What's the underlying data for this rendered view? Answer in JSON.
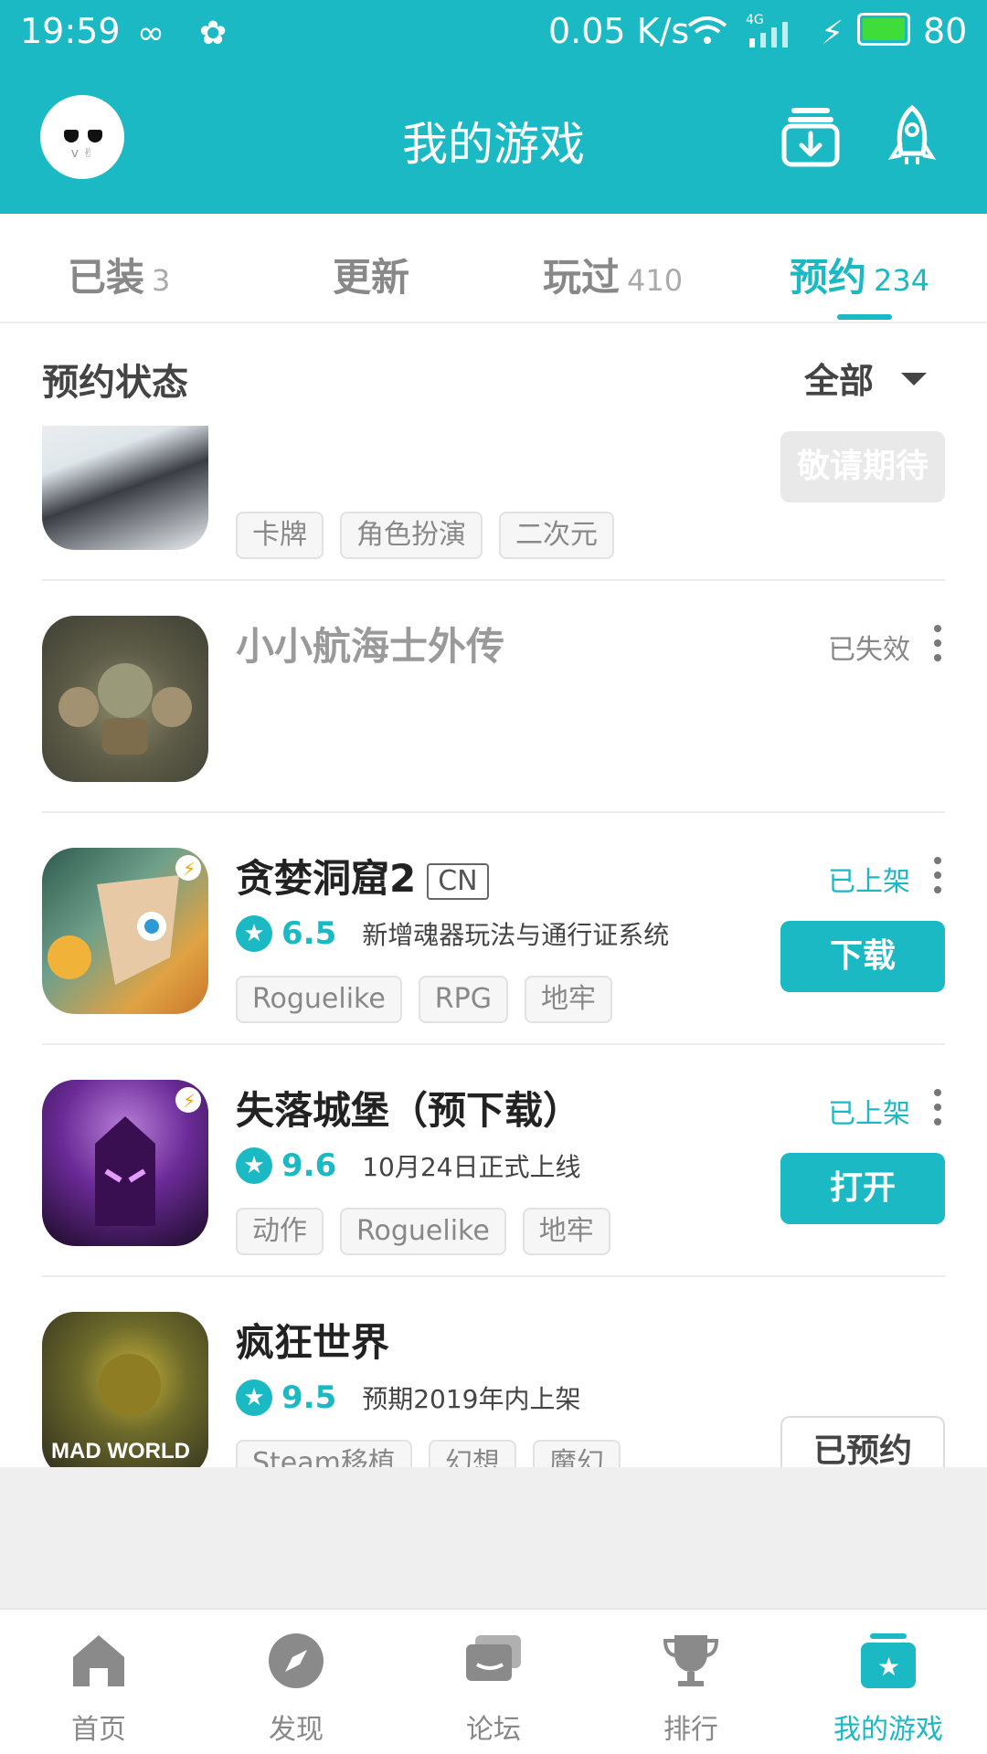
{
  "status_bar": {
    "time": "19:59",
    "speed": "0.05 K/s",
    "network": "4G",
    "battery": "80"
  },
  "header": {
    "title": "我的游戏"
  },
  "tabs": [
    {
      "label": "已装",
      "count": "3"
    },
    {
      "label": "更新",
      "count": ""
    },
    {
      "label": "玩过",
      "count": "410"
    },
    {
      "label": "预约",
      "count": "234",
      "active": true
    }
  ],
  "filter": {
    "label": "预约状态",
    "selected": "全部"
  },
  "games": [
    {
      "name": "",
      "status": "",
      "tags": [
        "卡牌",
        "角色扮演",
        "二次元"
      ],
      "button": "敬请期待"
    },
    {
      "name": "小小航海士外传",
      "status": "已失效",
      "tags": []
    },
    {
      "name": "贪婪洞窟2",
      "region": "CN",
      "status": "已上架",
      "score": "6.5",
      "desc": "新增魂器玩法与通行证系统",
      "tags": [
        "Roguelike",
        "RPG",
        "地牢"
      ],
      "button": "下载"
    },
    {
      "name": "失落城堡（预下载）",
      "status": "已上架",
      "score": "9.6",
      "desc": "10月24日正式上线",
      "tags": [
        "动作",
        "Roguelike",
        "地牢"
      ],
      "button": "打开"
    },
    {
      "name": "疯狂世界",
      "status": "",
      "score": "9.5",
      "desc": "预期2019年内上架",
      "tags": [
        "Steam移植",
        "幻想",
        "魔幻"
      ],
      "button": "已预约",
      "icon_text": "MAD WORLD"
    }
  ],
  "bottom_nav": [
    {
      "label": "首页",
      "icon": "home-icon"
    },
    {
      "label": "发现",
      "icon": "compass-icon"
    },
    {
      "label": "论坛",
      "icon": "chat-icon"
    },
    {
      "label": "排行",
      "icon": "trophy-icon"
    },
    {
      "label": "我的游戏",
      "icon": "my-games-icon",
      "active": true
    }
  ],
  "colors": {
    "accent": "#1bb9c4",
    "battery_fill": "#3fdc3a"
  }
}
